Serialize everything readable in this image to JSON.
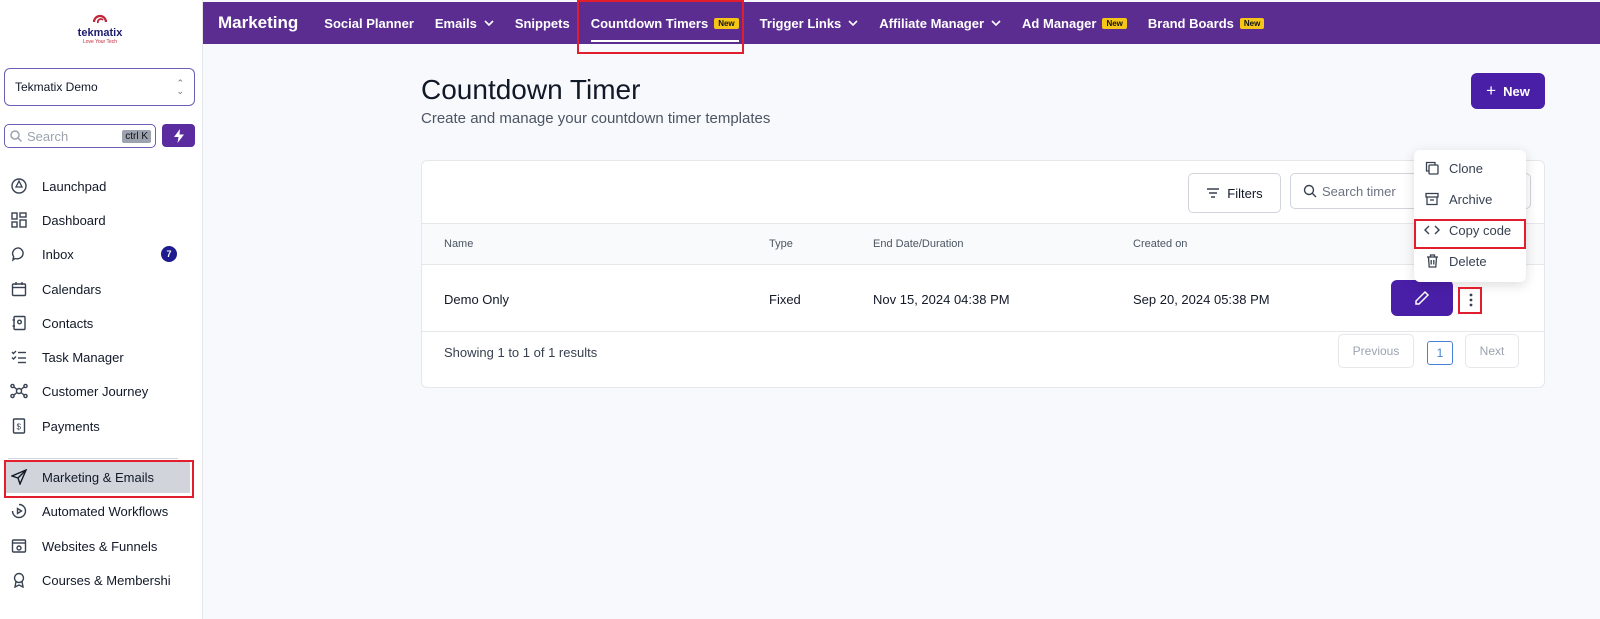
{
  "brand": {
    "logo_text": "tekmatix",
    "logo_tagline": "Love Your Tech",
    "accent_color": "#5b2d91",
    "button_color": "#4a1fa8"
  },
  "sidebar": {
    "account_name": "Tekmatix Demo",
    "search_placeholder": "Search",
    "search_shortcut": "ctrl K",
    "items": [
      {
        "label": "Launchpad",
        "icon": "rocket-icon"
      },
      {
        "label": "Dashboard",
        "icon": "grid-icon"
      },
      {
        "label": "Inbox",
        "icon": "chat-icon",
        "badge": "7"
      },
      {
        "label": "Calendars",
        "icon": "calendar-icon"
      },
      {
        "label": "Contacts",
        "icon": "contact-book-icon"
      },
      {
        "label": "Task Manager",
        "icon": "checklist-icon"
      },
      {
        "label": "Customer Journey",
        "icon": "network-icon"
      },
      {
        "label": "Payments",
        "icon": "receipt-icon"
      },
      {
        "label": "Marketing & Emails",
        "icon": "send-icon",
        "active": true
      },
      {
        "label": "Automated Workflows",
        "icon": "workflow-icon"
      },
      {
        "label": "Websites & Funnels",
        "icon": "browser-icon"
      },
      {
        "label": "Courses & Membershi",
        "icon": "award-icon"
      }
    ]
  },
  "topnav": {
    "section": "Marketing",
    "tabs": [
      {
        "label": "Social Planner"
      },
      {
        "label": "Emails",
        "dropdown": true
      },
      {
        "label": "Snippets"
      },
      {
        "label": "Countdown Timers",
        "badge": "New",
        "current": true
      },
      {
        "label": "Trigger Links",
        "dropdown": true
      },
      {
        "label": "Affiliate Manager",
        "dropdown": true
      },
      {
        "label": "Ad Manager",
        "badge": "New"
      },
      {
        "label": "Brand Boards",
        "badge": "New"
      }
    ]
  },
  "page": {
    "title": "Countdown Timer",
    "subtitle": "Create and manage your countdown timer templates",
    "new_button": "New"
  },
  "toolbar": {
    "filters_label": "Filters",
    "search_placeholder": "Search timer"
  },
  "table": {
    "columns": [
      "Name",
      "Type",
      "End Date/Duration",
      "Created on"
    ],
    "rows": [
      {
        "name": "Demo Only",
        "type": "Fixed",
        "end": "Nov 15, 2024 04:38 PM",
        "created": "Sep 20, 2024 05:38 PM"
      }
    ]
  },
  "pagination": {
    "summary": "Showing 1 to 1 of 1 results",
    "previous": "Previous",
    "current_page": "1",
    "next": "Next"
  },
  "row_menu": {
    "items": [
      {
        "label": "Clone",
        "icon": "copy-icon"
      },
      {
        "label": "Archive",
        "icon": "archive-icon"
      },
      {
        "label": "Copy code",
        "icon": "code-icon"
      },
      {
        "label": "Delete",
        "icon": "trash-icon"
      }
    ]
  }
}
